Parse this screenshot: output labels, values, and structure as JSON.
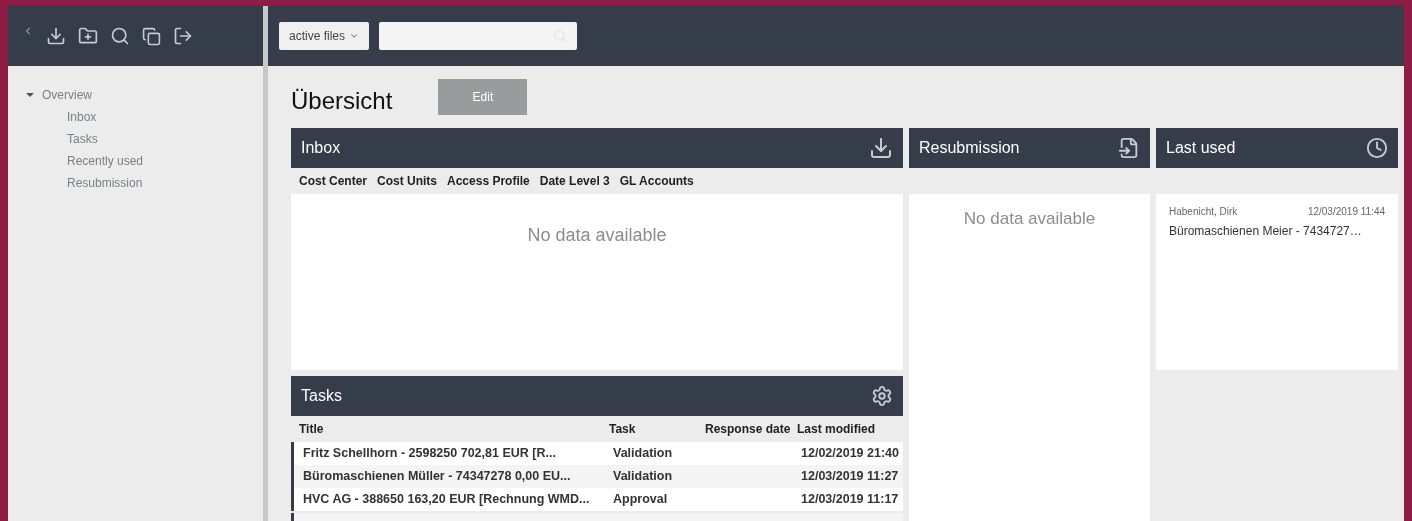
{
  "search": {
    "filter": "active files"
  },
  "sidebar": {
    "items": [
      {
        "label": "Overview",
        "expanded": true,
        "children": [
          {
            "label": "Inbox"
          },
          {
            "label": "Tasks"
          },
          {
            "label": "Recently used"
          },
          {
            "label": "Resubmission"
          }
        ]
      }
    ]
  },
  "page": {
    "title": "Übersicht",
    "edit_button": "Edit"
  },
  "inbox": {
    "title": "Inbox",
    "filters": [
      "Cost Center",
      "Cost Units",
      "Access Profile",
      "Date Level 3",
      "GL Accounts"
    ],
    "empty_text": "No data available"
  },
  "resubmission": {
    "title": "Resubmission",
    "empty_text": "No data available"
  },
  "last_used": {
    "title": "Last used",
    "items": [
      {
        "user": "Habenicht, Dirk",
        "date": "12/03/2019 11:44",
        "title": "Büromaschienen Meier - 7434727…"
      }
    ]
  },
  "tasks": {
    "title": "Tasks",
    "columns": [
      "Title",
      "Task",
      "Response date",
      "Last modified"
    ],
    "rows": [
      [
        "Fritz Schellhorn - 2598250 702,81 EUR [R...",
        "Validation",
        "",
        "12/02/2019 21:40"
      ],
      [
        "Büromaschienen Müller - 74347278 0,00 EU...",
        "Validation",
        "",
        "12/03/2019 11:27"
      ],
      [
        "HVC AG - 388650 163,20 EUR [Rechnung WMD...",
        "Approval",
        "",
        "12/03/2019 11:17"
      ]
    ]
  }
}
